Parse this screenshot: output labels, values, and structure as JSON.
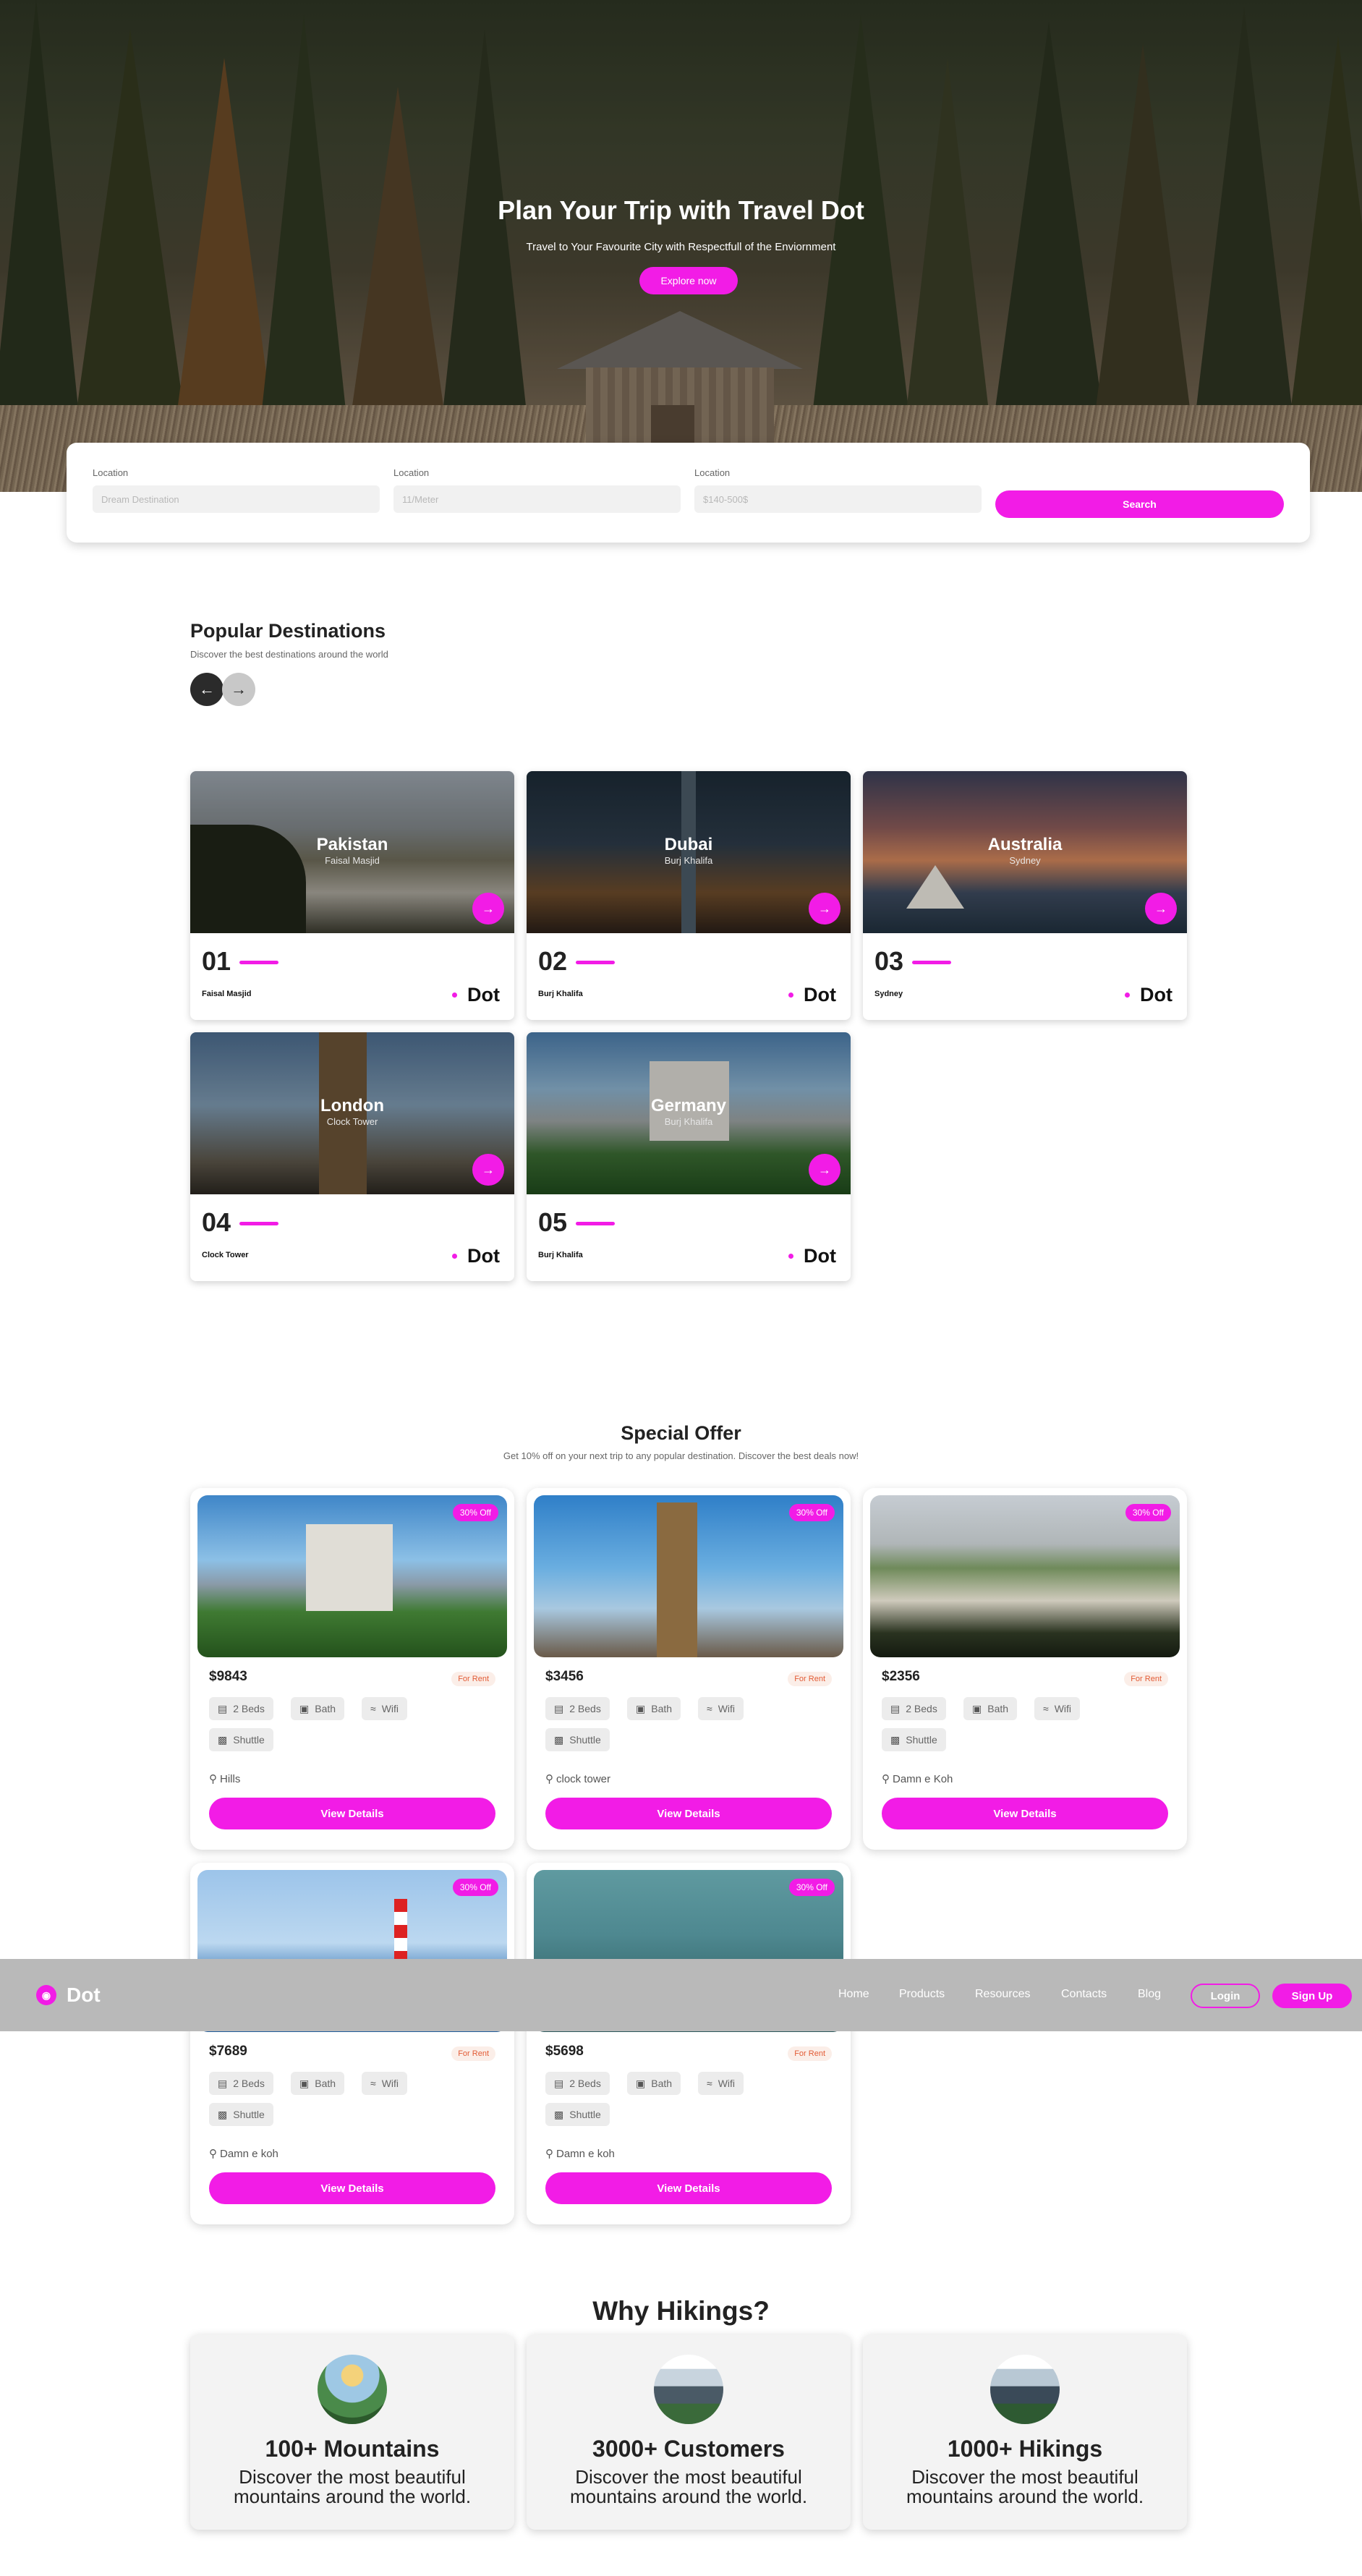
{
  "hero": {
    "title": "Plan Your Trip with Travel Dot",
    "subtitle": "Travel to Your Favourite City with Respectfull of the Enviornment",
    "cta": "Explore now"
  },
  "search": {
    "fields": [
      {
        "label": "Location",
        "placeholder": "Dream Destination"
      },
      {
        "label": "Location",
        "placeholder": "11/Meter"
      },
      {
        "label": "Location",
        "placeholder": "$140-500$"
      }
    ],
    "button": "Search"
  },
  "popular": {
    "title": "Popular Destinations",
    "subtitle": "Discover the best destinations around the world",
    "prev_icon": "arrow-left-icon",
    "next_icon": "arrow-right-icon",
    "cards": [
      {
        "name": "Pakistan",
        "place": "Faisal Masjid",
        "number": "01",
        "label": "Faisal Masjid",
        "brand": "Dot"
      },
      {
        "name": "Dubai",
        "place": "Burj Khalifa",
        "number": "02",
        "label": "Burj Khalifa",
        "brand": "Dot"
      },
      {
        "name": "Australia",
        "place": "Sydney",
        "number": "03",
        "label": "Sydney",
        "brand": "Dot"
      },
      {
        "name": "London",
        "place": "Clock Tower",
        "number": "04",
        "label": "Clock Tower",
        "brand": "Dot"
      },
      {
        "name": "Germany",
        "place": "Burj Khalifa",
        "number": "05",
        "label": "Burj Khalifa",
        "brand": "Dot"
      }
    ]
  },
  "offer": {
    "title": "Special Offer",
    "subtitle": "Get 10% off on your next trip to any popular destination. Discover the best deals now!",
    "cards": [
      {
        "badge": "30% Off",
        "price": "$9843",
        "tag": "For Rent",
        "beds": "2 Beds",
        "bath": "Bath",
        "wifi": "Wifi",
        "shuttle": "Shuttle",
        "location": "Hills",
        "button": "View Details"
      },
      {
        "badge": "30% Off",
        "price": "$3456",
        "tag": "For Rent",
        "beds": "2 Beds",
        "bath": "Bath",
        "wifi": "Wifi",
        "shuttle": "Shuttle",
        "location": "clock tower",
        "button": "View Details"
      },
      {
        "badge": "30% Off",
        "price": "$2356",
        "tag": "For Rent",
        "beds": "2 Beds",
        "bath": "Bath",
        "wifi": "Wifi",
        "shuttle": "Shuttle",
        "location": "Damn e Koh",
        "button": "View Details"
      },
      {
        "badge": "30% Off",
        "price": "$7689",
        "tag": "For Rent",
        "beds": "2 Beds",
        "bath": "Bath",
        "wifi": "Wifi",
        "shuttle": "Shuttle",
        "location": "Damn e koh",
        "button": "View Details"
      },
      {
        "badge": "30% Off",
        "price": "$5698",
        "tag": "For Rent",
        "beds": "2 Beds",
        "bath": "Bath",
        "wifi": "Wifi",
        "shuttle": "Shuttle",
        "location": "Damn e koh",
        "button": "View Details"
      }
    ]
  },
  "nav": {
    "logo": "Dot",
    "links": [
      "Home",
      "Products",
      "Resources",
      "Contacts",
      "Blog"
    ],
    "login": "Login",
    "signup": "Sign Up"
  },
  "why": {
    "title": "Why Hikings?",
    "cards": [
      {
        "head": "100+ Mountains",
        "text": "Discover the most beautiful mountains around the world."
      },
      {
        "head": "3000+ Customers",
        "text": "Discover the most beautiful mountains around the world."
      },
      {
        "head": "1000+ Hikings",
        "text": "Discover the most beautiful mountains around the world."
      }
    ]
  },
  "colors": {
    "accent": "#f21ce6",
    "nav_bg": "#b9b9b9",
    "dark": "#2b2b2b"
  }
}
